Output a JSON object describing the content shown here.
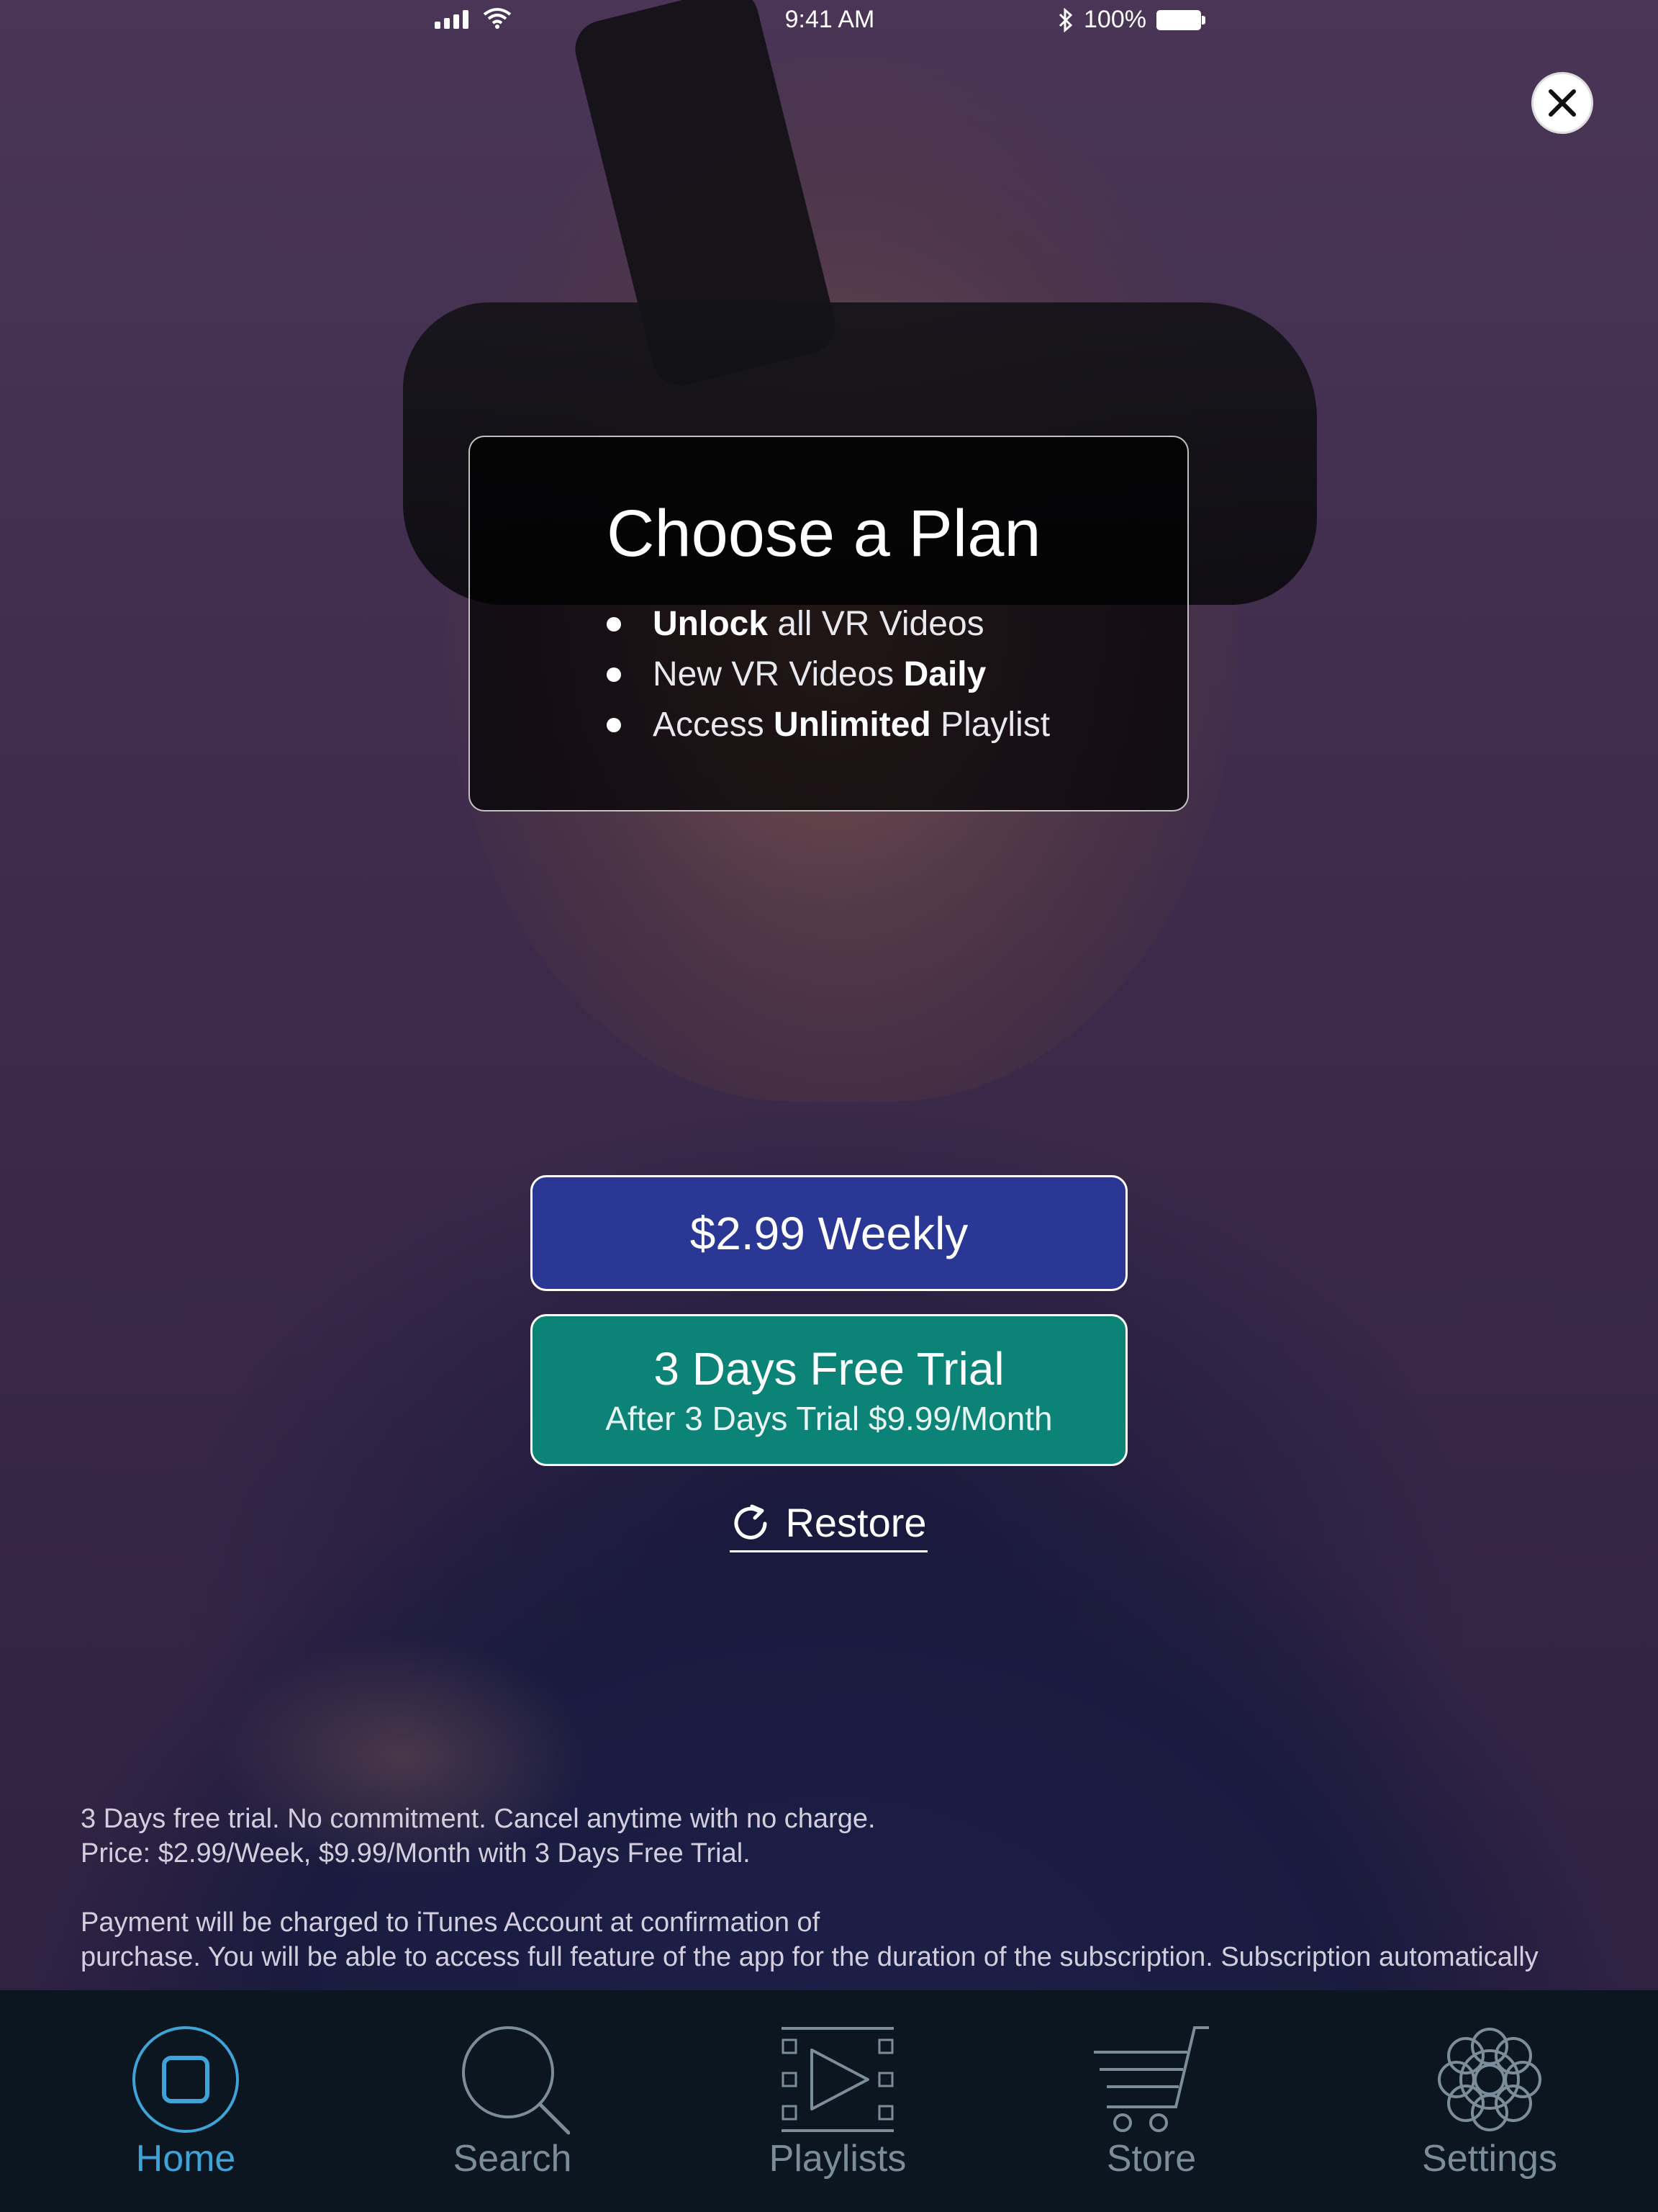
{
  "status_bar": {
    "time": "9:41 AM",
    "battery": "100%"
  },
  "paywall": {
    "title": "Choose a Plan",
    "features": [
      {
        "pre": "",
        "bold": "Unlock",
        "post": " all VR Videos"
      },
      {
        "pre": "New VR Videos ",
        "bold": "Daily",
        "post": ""
      },
      {
        "pre": "Access ",
        "bold": "Unlimited",
        "post": " Playlist"
      }
    ],
    "weekly_button": "$2.99 Weekly",
    "trial_button": {
      "title": "3 Days Free Trial",
      "subtitle": "After 3 Days Trial $9.99/Month"
    },
    "restore_label": "Restore",
    "legal": {
      "line1": "3 Days free trial. No commitment. Cancel anytime with no charge.",
      "line2": "Price: $2.99/Week, $9.99/Month with 3 Days Free Trial.",
      "line3": "Payment will be charged to iTunes Account at confirmation of",
      "line4": "purchase. You will be able to access full feature of the app for the duration of the subscription. Subscription automatically"
    }
  },
  "tabbar": {
    "active": "home",
    "accent_color": "#3ea4d8",
    "inactive_color": "#7c8d9a",
    "items": [
      {
        "id": "home",
        "label": "Home",
        "icon": "home-square-icon"
      },
      {
        "id": "search",
        "label": "Search",
        "icon": "search-icon"
      },
      {
        "id": "playlists",
        "label": "Playlists",
        "icon": "playlist-film-icon"
      },
      {
        "id": "store",
        "label": "Store",
        "icon": "cart-icon"
      },
      {
        "id": "settings",
        "label": "Settings",
        "icon": "gear-icon"
      }
    ]
  }
}
